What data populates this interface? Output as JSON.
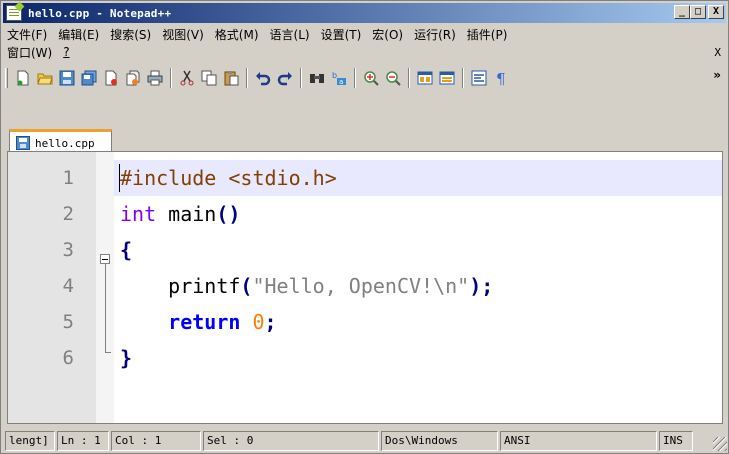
{
  "window": {
    "title": "hello.cpp - Notepad++",
    "buttons": {
      "minimize": "_",
      "maximize": "□",
      "close": "X"
    }
  },
  "menu": {
    "row1": [
      "文件(F)",
      "编辑(E)",
      "搜索(S)",
      "视图(V)",
      "格式(M)",
      "语言(L)",
      "设置(T)",
      "宏(O)",
      "运行(R)",
      "插件(P)"
    ],
    "row2": [
      "窗口(W)",
      "?"
    ],
    "close_doc": "X"
  },
  "toolbar": {
    "overflow": "»",
    "icons": [
      "new-icon",
      "open-icon",
      "save-icon",
      "save-all-icon",
      "close-icon",
      "close-all-icon",
      "print-icon",
      "cut-icon",
      "copy-icon",
      "paste-icon",
      "undo-icon",
      "redo-icon",
      "find-icon",
      "replace-icon",
      "zoom-in-icon",
      "zoom-out-icon",
      "sync-v-icon",
      "sync-h-icon",
      "word-wrap-icon",
      "show-all-chars-icon"
    ]
  },
  "tabs": [
    {
      "label": "hello.cpp",
      "active": true
    }
  ],
  "editor": {
    "lines": [
      {
        "num": "1"
      },
      {
        "num": "2"
      },
      {
        "num": "3"
      },
      {
        "num": "4"
      },
      {
        "num": "5"
      },
      {
        "num": "6"
      }
    ],
    "tokens": {
      "l1": "#include <stdio.h>",
      "l2_kw": "int",
      "l2_fn": " main",
      "l2_op": "()",
      "l3_op": "{",
      "l4_indent": "    ",
      "l4_fn": "printf",
      "l4_op1": "(",
      "l4_str": "\"Hello, OpenCV!\\n\"",
      "l4_op2": ");",
      "l5_indent": "    ",
      "l5_kw": "return",
      "l5_num": " 0",
      "l5_op": ";",
      "l6_op": "}"
    }
  },
  "status": {
    "length": "lengt]",
    "ln": "Ln : 1",
    "col": "Col : 1",
    "sel": "Sel : 0",
    "eol": "Dos\\Windows",
    "encoding": "ANSI",
    "mode": "INS"
  },
  "colors": {
    "title_start": "#0a246a",
    "title_end": "#a6caf0",
    "tab_accent": "#f0a030",
    "current_line": "#e8e8ff",
    "keyword": "#8000ff",
    "keyword_bold": "#0000ff",
    "string": "#808080",
    "number": "#ff8000",
    "preprocessor": "#804000"
  }
}
